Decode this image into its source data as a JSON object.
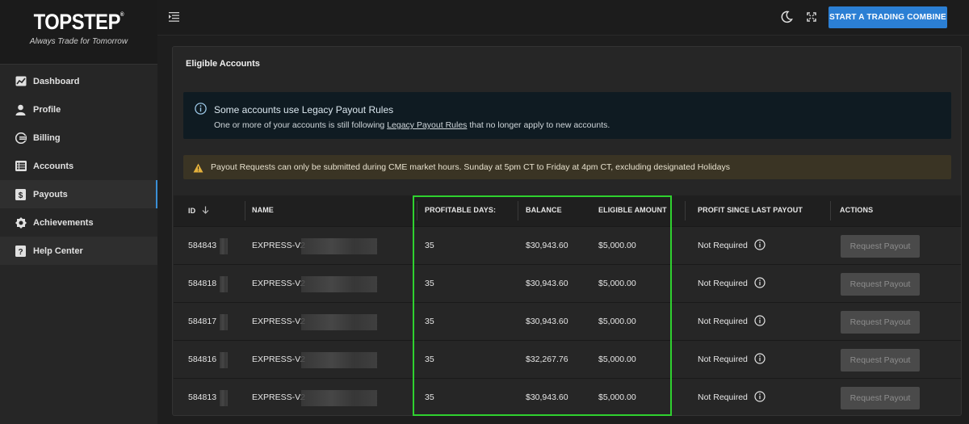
{
  "brand": {
    "name": "TOPSTEP",
    "mark": "®",
    "tagline": "Always Trade for Tomorrow"
  },
  "sidebar": {
    "items": [
      {
        "label": "Dashboard",
        "icon": "chart-icon"
      },
      {
        "label": "Profile",
        "icon": "user-icon"
      },
      {
        "label": "Billing",
        "icon": "billing-icon"
      },
      {
        "label": "Accounts",
        "icon": "list-icon"
      },
      {
        "label": "Payouts",
        "icon": "dollar-icon",
        "active": true
      },
      {
        "label": "Achievements",
        "icon": "badge-icon"
      },
      {
        "label": "Help Center",
        "icon": "question-icon"
      }
    ]
  },
  "topbar": {
    "cta_label": "START A TRADING COMBINE",
    "accent": "#2b7fd4"
  },
  "card": {
    "title": "Eligible Accounts",
    "info": {
      "title": "Some accounts use Legacy Payout Rules",
      "text_before": "One or more of your accounts is still following ",
      "link": "Legacy Payout Rules",
      "text_after": " that no longer apply to new accounts."
    },
    "warning": "Payout Requests can only be submitted during CME market hours. Sunday at 5pm CT to Friday at 4pm CT, excluding designated Holidays"
  },
  "table": {
    "columns": [
      "ID",
      "NAME",
      "PROFITABLE DAYS:",
      "BALANCE",
      "ELIGIBLE AMOUNT",
      "PROFIT SINCE LAST PAYOUT",
      "ACTIONS"
    ],
    "rows": [
      {
        "id": "584843",
        "name": "EXPRESS-V2",
        "days": "35",
        "balance": "$30,943.60",
        "eligible": "$5,000.00",
        "profit": "Not Required",
        "action": "Request Payout"
      },
      {
        "id": "584818",
        "name": "EXPRESS-V2",
        "days": "35",
        "balance": "$30,943.60",
        "eligible": "$5,000.00",
        "profit": "Not Required",
        "action": "Request Payout"
      },
      {
        "id": "584817",
        "name": "EXPRESS-V2",
        "days": "35",
        "balance": "$30,943.60",
        "eligible": "$5,000.00",
        "profit": "Not Required",
        "action": "Request Payout"
      },
      {
        "id": "584816",
        "name": "EXPRESS-V2",
        "days": "35",
        "balance": "$32,267.76",
        "eligible": "$5,000.00",
        "profit": "Not Required",
        "action": "Request Payout"
      },
      {
        "id": "584813",
        "name": "EXPRESS-V2",
        "days": "35",
        "balance": "$30,943.60",
        "eligible": "$5,000.00",
        "profit": "Not Required",
        "action": "Request Payout"
      }
    ]
  }
}
